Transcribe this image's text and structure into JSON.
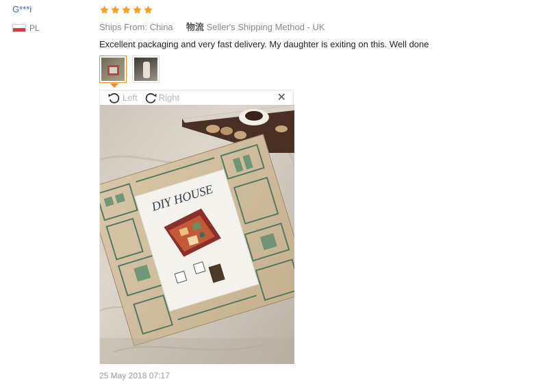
{
  "reviewer": {
    "name": "G***i",
    "country": "PL",
    "flag_colors": [
      "#ffffff",
      "#dc3b3b"
    ]
  },
  "review": {
    "rating": 5,
    "star_color": "#f5a21b",
    "ships_from": "Ships From: China",
    "shipping_label": "物流",
    "shipping_method": "Seller's Shipping Method - UK",
    "feedback": "Excellent packaging and very fast delivery. My daughter is exiting on this. Well done",
    "date": "25 May 2018 07:17"
  },
  "thumbnails": [
    {
      "name": "review-photo-1",
      "active": true
    },
    {
      "name": "review-photo-2",
      "active": false
    }
  ],
  "viewer": {
    "rotate_left_label": "Left",
    "rotate_right_label": "Right",
    "close_icon": "close-icon",
    "photo_box_text": "DIY HOUSE"
  },
  "accent_color": "#f08a24",
  "link_color": "#3b6bb0"
}
